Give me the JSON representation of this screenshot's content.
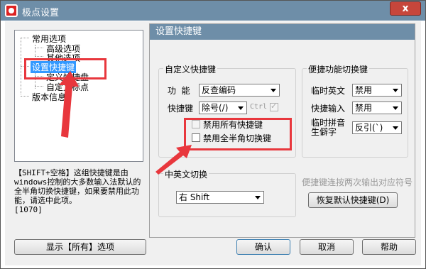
{
  "window": {
    "title": "极点设置",
    "close_label": "x"
  },
  "tree": {
    "items": [
      {
        "label": "常用选项"
      },
      {
        "label": "高级选项"
      },
      {
        "label": "其他选项"
      },
      {
        "label": "设置快捷键"
      },
      {
        "label": "定义快捷盘"
      },
      {
        "label": "自定义标点"
      },
      {
        "label": "版本信息"
      }
    ]
  },
  "description": "【SHIFT+空格】这组快捷键是由windows控制的大多数输入法默认的全半角切换快捷键，如果要禁用此功能，请选中此项。\n[1070]",
  "panel": {
    "title": "设置快捷键",
    "custom_group": {
      "title": "自定义快捷键",
      "function_label": "功  能",
      "function_value": "反查编码",
      "hotkey_label": "快捷键",
      "hotkey_value": "除号(/)",
      "ctrl_label": "Ctrl",
      "disable_all_label": "禁用所有快捷键",
      "disable_fullhalf_label": "禁用全半角切换键"
    },
    "quick_group": {
      "title": "便捷功能切换键",
      "temp_english_label": "临时英文",
      "temp_english_value": "禁用",
      "quick_input_label": "快捷输入",
      "quick_input_value": "禁用",
      "temp_pinyin_label": "临时拼音\n生僻字",
      "temp_pinyin_value": "反引(`)"
    },
    "cn_en_group": {
      "title": "中英文切换",
      "value": "右 Shift"
    },
    "hint": "便捷键连按两次输出对应符号",
    "restore_label": "恢复默认快捷键(D)"
  },
  "buttons": {
    "show_all": "显示【所有】选项",
    "ok": "确认",
    "cancel": "取消",
    "help": "帮助"
  },
  "colors": {
    "accent": "#6e8ea8",
    "selection": "#3399ff",
    "annotation": "#e8373d"
  }
}
